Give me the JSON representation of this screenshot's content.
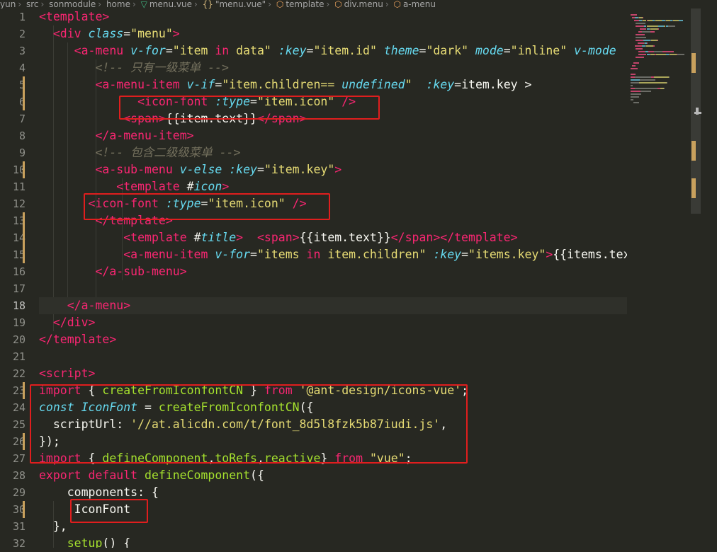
{
  "breadcrumb": [
    "yun",
    "src",
    "sonmodule",
    "home",
    "menu.vue",
    "\"menu.vue\"",
    "template",
    "div.menu",
    "a-menu"
  ],
  "breadcrumb_icons": [
    "vue-icon",
    "braces-icon",
    "cube-icon"
  ],
  "icons": {
    "braces_glyph": "{}"
  },
  "editor": {
    "current_line": 18,
    "lines": [
      {
        "n": "1",
        "tokens": [
          [
            "t-plain",
            ""
          ],
          [
            "t-tag",
            "<template>"
          ]
        ]
      },
      {
        "n": "2",
        "tokens": [
          [
            "t-plain",
            "  "
          ],
          [
            "t-tag",
            "<div "
          ],
          [
            "t-attr",
            "class"
          ],
          [
            "t-plain",
            "="
          ],
          [
            "t-string",
            "\"menu\""
          ],
          [
            "t-tag",
            ">"
          ]
        ]
      },
      {
        "n": "3",
        "tokens": [
          [
            "t-plain",
            "     "
          ],
          [
            "t-tag",
            "<a-menu "
          ],
          [
            "t-attr",
            "v-for"
          ],
          [
            "t-plain",
            "="
          ],
          [
            "t-string",
            "\"item "
          ],
          [
            "t-keyword",
            "in"
          ],
          [
            "t-string",
            " data\" "
          ],
          [
            "t-attr",
            ":key"
          ],
          [
            "t-plain",
            "="
          ],
          [
            "t-string",
            "\"item.id\" "
          ],
          [
            "t-attr",
            "theme"
          ],
          [
            "t-plain",
            "="
          ],
          [
            "t-string",
            "\"dark\" "
          ],
          [
            "t-attr",
            "mode"
          ],
          [
            "t-plain",
            "="
          ],
          [
            "t-string",
            "\"inline\" "
          ],
          [
            "t-attr",
            "v-mode"
          ]
        ]
      },
      {
        "n": "4",
        "tokens": [
          [
            "t-plain",
            "        "
          ],
          [
            "t-comment",
            "<!-- 只有一级菜单 -->"
          ]
        ]
      },
      {
        "n": "5",
        "tokens": [
          [
            "t-plain",
            "        "
          ],
          [
            "t-tag",
            "<a-menu-item "
          ],
          [
            "t-attr",
            "v-if"
          ],
          [
            "t-plain",
            "="
          ],
          [
            "t-string",
            "\"item.children== "
          ],
          [
            "t-type",
            "undefined"
          ],
          [
            "t-string",
            "\"  "
          ],
          [
            "t-attr",
            ":key"
          ],
          [
            "t-plain",
            "=item.key >"
          ]
        ]
      },
      {
        "n": "6",
        "tokens": [
          [
            "t-plain",
            "              "
          ],
          [
            "t-tag",
            "<icon-font "
          ],
          [
            "t-attr",
            ":type"
          ],
          [
            "t-plain",
            "="
          ],
          [
            "t-string",
            "\"item.icon\" "
          ],
          [
            "t-tag",
            "/>"
          ]
        ]
      },
      {
        "n": "7",
        "tokens": [
          [
            "t-plain",
            "            "
          ],
          [
            "t-tag",
            "<span>"
          ],
          [
            "t-plain",
            "{{item.text}}"
          ],
          [
            "t-tag",
            "</span>"
          ]
        ]
      },
      {
        "n": "8",
        "tokens": [
          [
            "t-plain",
            "        "
          ],
          [
            "t-tag",
            "</a-menu-item>"
          ]
        ]
      },
      {
        "n": "9",
        "tokens": [
          [
            "t-plain",
            "        "
          ],
          [
            "t-comment",
            "<!-- 包含二级级菜单 -->"
          ]
        ]
      },
      {
        "n": "10",
        "tokens": [
          [
            "t-plain",
            "        "
          ],
          [
            "t-tag",
            "<a-sub-menu "
          ],
          [
            "t-attr",
            "v-else "
          ],
          [
            "t-attr",
            ":key"
          ],
          [
            "t-plain",
            "="
          ],
          [
            "t-string",
            "\"item.key\""
          ],
          [
            "t-tag",
            ">"
          ]
        ]
      },
      {
        "n": "11",
        "tokens": [
          [
            "t-plain",
            "           "
          ],
          [
            "t-tag",
            "<template "
          ],
          [
            "t-plain",
            "#"
          ],
          [
            "t-attr",
            "icon"
          ],
          [
            "t-tag",
            ">"
          ]
        ]
      },
      {
        "n": "12",
        "tokens": [
          [
            "t-plain",
            "       "
          ],
          [
            "t-tag",
            "<icon-font "
          ],
          [
            "t-attr",
            ":type"
          ],
          [
            "t-plain",
            "="
          ],
          [
            "t-string",
            "\"item.icon\" "
          ],
          [
            "t-tag",
            "/>"
          ]
        ]
      },
      {
        "n": "13",
        "tokens": [
          [
            "t-plain",
            "        "
          ],
          [
            "t-tag",
            "</template>"
          ]
        ]
      },
      {
        "n": "14",
        "tokens": [
          [
            "t-plain",
            "            "
          ],
          [
            "t-tag",
            "<template "
          ],
          [
            "t-plain",
            "#"
          ],
          [
            "t-attr",
            "title"
          ],
          [
            "t-tag",
            ">  <span>"
          ],
          [
            "t-plain",
            "{{item.text}}"
          ],
          [
            "t-tag",
            "</span></template>"
          ]
        ]
      },
      {
        "n": "15",
        "tokens": [
          [
            "t-plain",
            "            "
          ],
          [
            "t-tag",
            "<a-menu-item "
          ],
          [
            "t-attr",
            "v-for"
          ],
          [
            "t-plain",
            "="
          ],
          [
            "t-string",
            "\"items "
          ],
          [
            "t-keyword",
            "in"
          ],
          [
            "t-string",
            " item.children\" "
          ],
          [
            "t-attr",
            ":key"
          ],
          [
            "t-plain",
            "="
          ],
          [
            "t-string",
            "\"items.key\""
          ],
          [
            "t-tag",
            ">"
          ],
          [
            "t-plain",
            "{{items.tex"
          ]
        ]
      },
      {
        "n": "16",
        "tokens": [
          [
            "t-plain",
            "        "
          ],
          [
            "t-tag",
            "</a-sub-menu>"
          ]
        ]
      },
      {
        "n": "17",
        "tokens": [
          [
            "t-plain",
            ""
          ]
        ]
      },
      {
        "n": "18",
        "tokens": [
          [
            "t-plain",
            "    "
          ],
          [
            "t-tag",
            "</a-menu>"
          ]
        ]
      },
      {
        "n": "19",
        "tokens": [
          [
            "t-plain",
            "  "
          ],
          [
            "t-tag",
            "</div>"
          ]
        ]
      },
      {
        "n": "20",
        "tokens": [
          [
            "t-tag",
            "</template>"
          ]
        ]
      },
      {
        "n": "21",
        "tokens": [
          [
            "t-plain",
            ""
          ]
        ]
      },
      {
        "n": "22",
        "tokens": [
          [
            "t-tag",
            "<script>"
          ]
        ]
      },
      {
        "n": "23",
        "tokens": [
          [
            "t-keyword",
            "import "
          ],
          [
            "t-plain",
            "{ "
          ],
          [
            "t-fn",
            "createFromIconfontCN"
          ],
          [
            "t-plain",
            " } "
          ],
          [
            "t-keyword",
            "from "
          ],
          [
            "t-string",
            "'@ant-design/icons-vue'"
          ],
          [
            "t-plain",
            ";"
          ]
        ]
      },
      {
        "n": "24",
        "tokens": [
          [
            "t-type",
            "const "
          ],
          [
            "t-type",
            "IconFont"
          ],
          [
            "t-plain",
            " = "
          ],
          [
            "t-fn",
            "createFromIconfontCN"
          ],
          [
            "t-plain",
            "({"
          ]
        ]
      },
      {
        "n": "25",
        "tokens": [
          [
            "t-plain",
            "  scriptUrl: "
          ],
          [
            "t-string",
            "'//at.alicdn.com/t/font_8d5l8fzk5b87iudi.js'"
          ],
          [
            "t-plain",
            ","
          ]
        ]
      },
      {
        "n": "26",
        "tokens": [
          [
            "t-plain",
            "});"
          ]
        ]
      },
      {
        "n": "27",
        "tokens": [
          [
            "t-keyword",
            "import "
          ],
          [
            "t-plain",
            "{ "
          ],
          [
            "t-fn",
            "defineComponent"
          ],
          [
            "t-plain",
            ","
          ],
          [
            "t-fn",
            "toRefs"
          ],
          [
            "t-plain",
            ","
          ],
          [
            "t-fn",
            "reactive"
          ],
          [
            "t-plain",
            "} "
          ],
          [
            "t-keyword",
            "from "
          ],
          [
            "t-string",
            "\"vue\""
          ],
          [
            "t-plain",
            ";"
          ]
        ]
      },
      {
        "n": "28",
        "tokens": [
          [
            "t-keyword",
            "export default "
          ],
          [
            "t-fn",
            "defineComponent"
          ],
          [
            "t-plain",
            "({"
          ]
        ]
      },
      {
        "n": "29",
        "tokens": [
          [
            "t-plain",
            "    components: {"
          ]
        ]
      },
      {
        "n": "30",
        "tokens": [
          [
            "t-plain",
            "     IconFont"
          ]
        ]
      },
      {
        "n": "31",
        "tokens": [
          [
            "t-plain",
            "  },"
          ]
        ]
      },
      {
        "n": "32",
        "tokens": [
          [
            "t-plain",
            "    "
          ],
          [
            "t-fn",
            "setup"
          ],
          [
            "t-plain",
            "() {"
          ]
        ]
      }
    ]
  }
}
